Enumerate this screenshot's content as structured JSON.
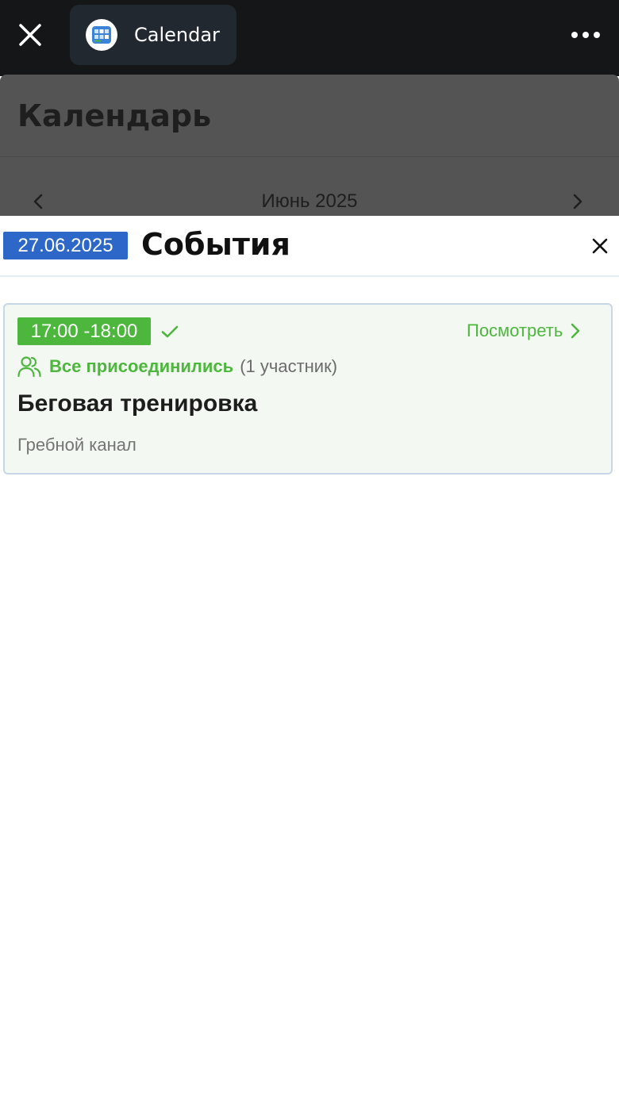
{
  "app_bar": {
    "app_title": "Calendar"
  },
  "background_page": {
    "title": "Календарь",
    "month": "Июнь 2025"
  },
  "sheet": {
    "date": "27.06.2025",
    "title": "События"
  },
  "event": {
    "time": "17:00 -18:00",
    "view_label": "Посмотреть",
    "joined_status": "Все присоединились",
    "participants_count": "(1 участник)",
    "name": "Беговая тренировка",
    "location": "Гребной канал"
  },
  "colors": {
    "accent_green": "#4db73d",
    "date_blue": "#2d67c7",
    "topbar": "#151618"
  }
}
